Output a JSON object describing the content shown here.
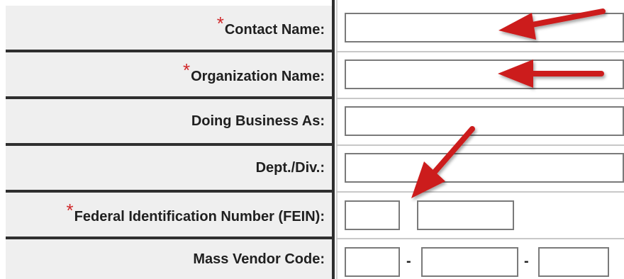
{
  "form": {
    "required_mark": "*",
    "fields": {
      "contact_name": {
        "label": "Contact Name:",
        "value": ""
      },
      "organization_name": {
        "label": "Organization Name:",
        "value": ""
      },
      "doing_business_as": {
        "label": "Doing Business As:",
        "value": ""
      },
      "dept_div": {
        "label": "Dept./Div.:",
        "value": ""
      },
      "fein": {
        "label": "Federal Identification Number (FEIN):",
        "part1": "",
        "part2": ""
      },
      "mass_vendor_code": {
        "label": "Mass Vendor Code:",
        "part1": "",
        "part2": "",
        "part3": "",
        "separator": "-"
      }
    }
  },
  "annotations": {
    "arrow_color": "#cc1f1f",
    "arrows": [
      "arrow-to-contact-name",
      "arrow-to-organization-name",
      "arrow-to-fein"
    ]
  },
  "colors": {
    "required": "#d0282a",
    "label_bg": "#efefef",
    "divider": "#2f2f2f",
    "input_border": "#7a7a7a"
  }
}
